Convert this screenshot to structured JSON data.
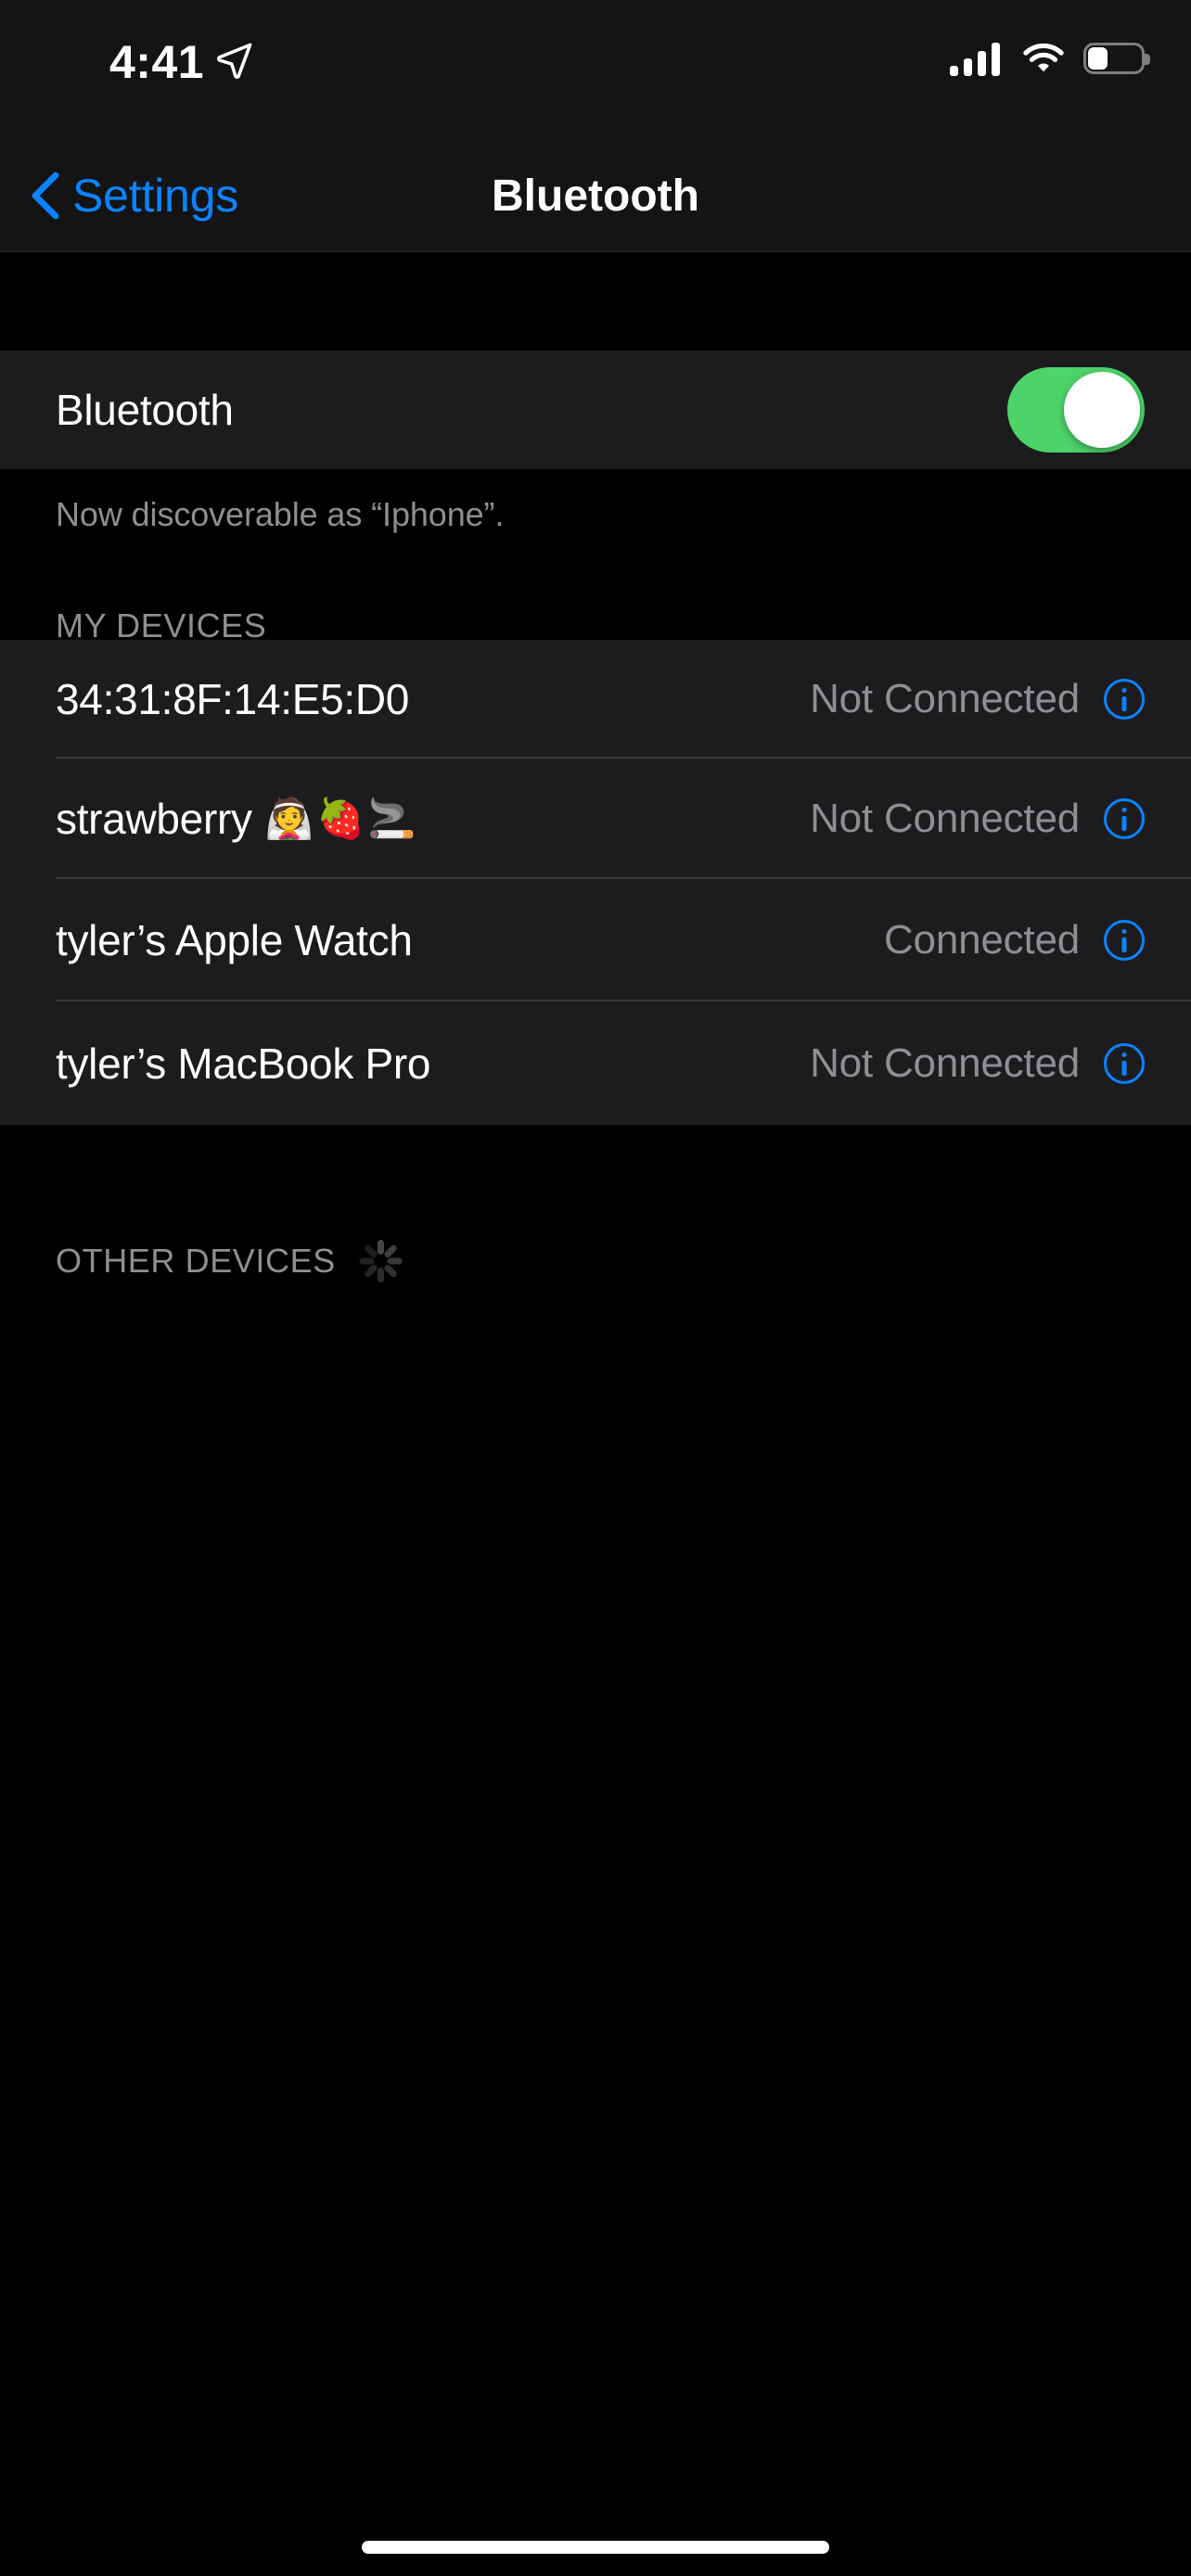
{
  "status_bar": {
    "time": "4:41",
    "location_icon": "location-arrow-icon",
    "cellular_icon": "cellular-signal-icon",
    "cellular_bars": 4,
    "wifi_icon": "wifi-icon",
    "battery_icon": "battery-icon",
    "battery_percent": 38
  },
  "nav": {
    "back_icon": "chevron-left-icon",
    "back_label": "Settings",
    "title": "Bluetooth"
  },
  "bluetooth_toggle": {
    "label": "Bluetooth",
    "state": "on",
    "on_color": "#4cd369"
  },
  "footnote": "Now discoverable as “Iphone”.",
  "my_devices": {
    "header": "MY DEVICES",
    "devices": [
      {
        "name": "34:31:8F:14:E5:D0",
        "emoji": "",
        "status": "Not Connected",
        "info_icon": "info-circle-icon"
      },
      {
        "name": "strawberry",
        "emoji": "👰🍓🚬",
        "status": "Not Connected",
        "info_icon": "info-circle-icon"
      },
      {
        "name": "tyler’s Apple Watch",
        "emoji": "",
        "status": "Connected",
        "info_icon": "info-circle-icon"
      },
      {
        "name": "tyler’s MacBook Pro",
        "emoji": "",
        "status": "Not Connected",
        "info_icon": "info-circle-icon"
      }
    ]
  },
  "other_devices": {
    "header": "OTHER DEVICES",
    "spinner_icon": "activity-spinner-icon",
    "devices": []
  },
  "home_indicator": "home-indicator",
  "colors": {
    "accent_blue": "#0a84ff",
    "toggle_green": "#4cd369",
    "secondary_text": "#8e8e93",
    "card_bg": "#1c1c1e",
    "page_bg": "#000000"
  }
}
